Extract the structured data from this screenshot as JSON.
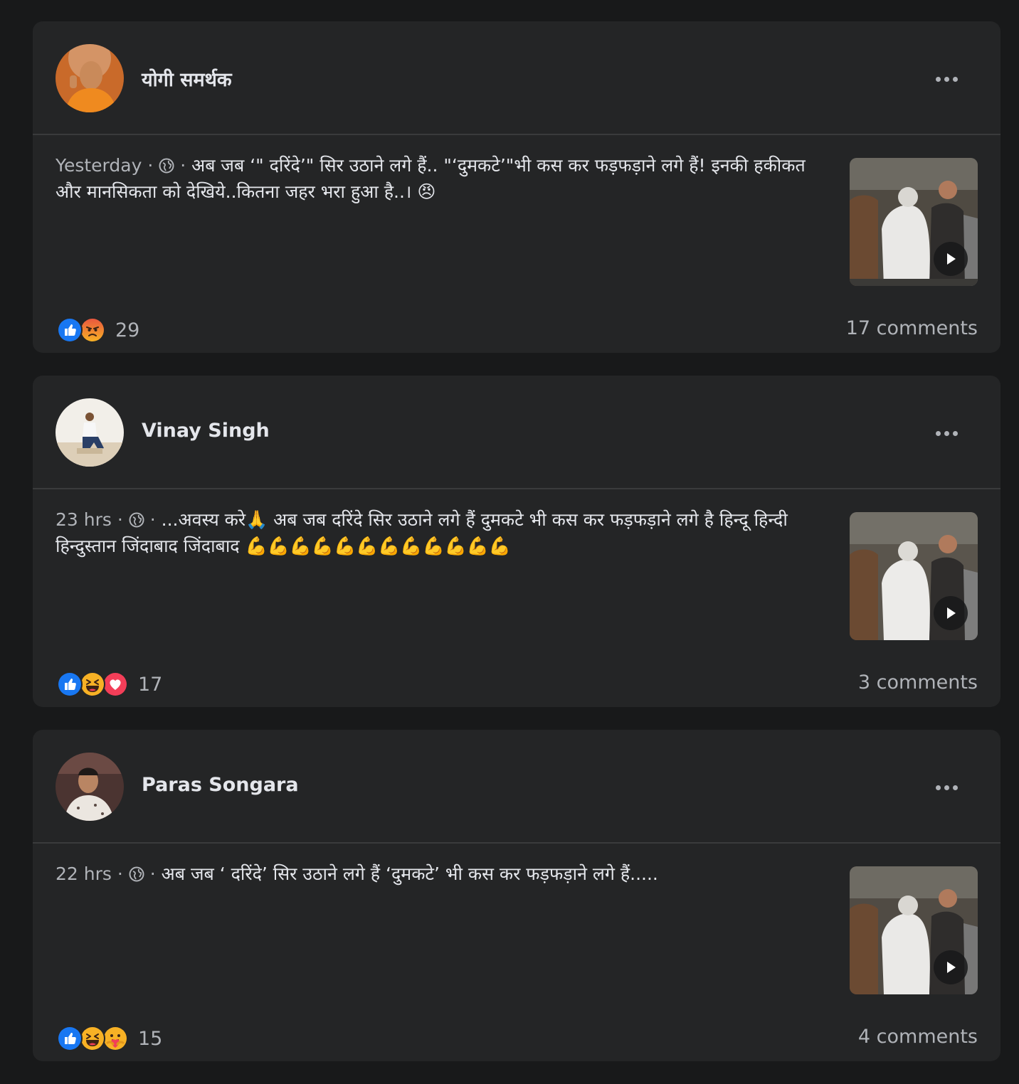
{
  "posts": [
    {
      "author": "योगी समर्थक",
      "time": "Yesterday",
      "separator": "·",
      "privacy_icon": "globe-icon",
      "text": "अब जब ‘\" दरिंदे’\" सिर उठाने लगे हैं.. \"‘दुमकटे’\"भी कस कर फड़फड़ाने लगे हैं! इनकी हकीकत और मानसिकता को देखिये..कितना जहर भरा हुआ है..। 😠",
      "reactions": [
        "like",
        "angry"
      ],
      "reaction_count": "29",
      "comments": "17 comments",
      "avatar_colors": [
        "#e27a2b",
        "#f3b46a",
        "#7a3b12"
      ]
    },
    {
      "author": "Vinay Singh",
      "time": "23 hrs",
      "separator": "·",
      "privacy_icon": "globe-icon",
      "text": "...अवस्य करे🙏 अब जब दरिंदे सिर उठाने लगे हैं दुमकटे भी कस कर फड़फड़ाने लगे है हिन्दू हिन्दी हिन्दुस्तान जिंदाबाद जिंदाबाद 💪💪💪💪💪💪💪💪💪💪💪💪",
      "reactions": [
        "like",
        "haha",
        "love"
      ],
      "reaction_count": "17",
      "comments": "3 comments",
      "avatar_colors": [
        "#f4f0ea",
        "#d9c7a8",
        "#2a3f66"
      ]
    },
    {
      "author": "Paras Songara",
      "time": "22 hrs",
      "separator": "·",
      "privacy_icon": "globe-icon",
      "text": "अब जब ‘ दरिंदे’ सिर उठाने लगे हैं ‘दुमकटे’ भी कस कर फड़फड़ाने लगे हैं.....",
      "reactions": [
        "like",
        "haha",
        "care"
      ],
      "reaction_count": "15",
      "comments": "4 comments",
      "avatar_colors": [
        "#5a3b36",
        "#e8e2dc",
        "#2b2222"
      ]
    }
  ],
  "ui": {
    "more_icon": "more-horizontal-icon",
    "play_icon": "play-icon",
    "colors": {
      "background": "#18191a",
      "card": "#242526",
      "divider": "#3a3b3c",
      "primary_text": "#e4e6eb",
      "secondary_text": "#b0b3b8",
      "like": "#1877f2",
      "love": "#f33e58",
      "emoji": "#f7b125"
    }
  }
}
